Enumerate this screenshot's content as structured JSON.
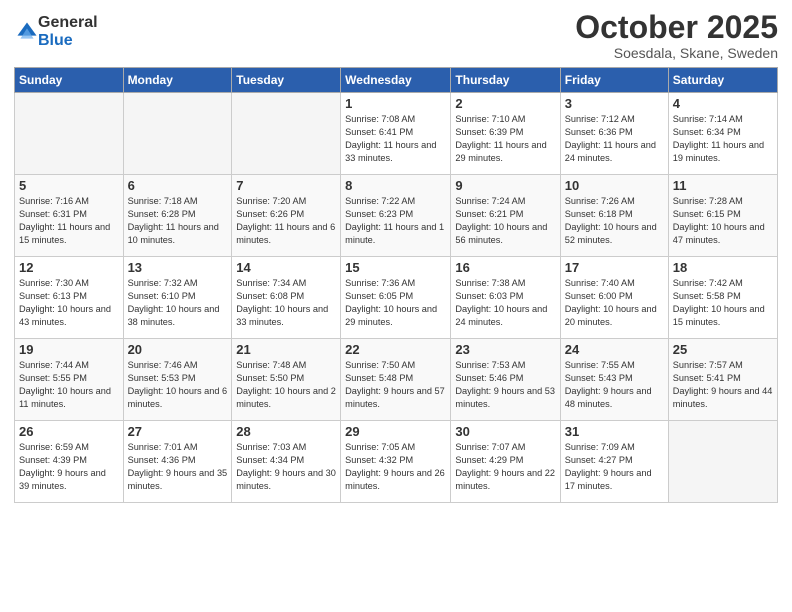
{
  "logo": {
    "general": "General",
    "blue": "Blue"
  },
  "title": "October 2025",
  "subtitle": "Soesdala, Skane, Sweden",
  "days_of_week": [
    "Sunday",
    "Monday",
    "Tuesday",
    "Wednesday",
    "Thursday",
    "Friday",
    "Saturday"
  ],
  "weeks": [
    [
      {
        "day": "",
        "info": ""
      },
      {
        "day": "",
        "info": ""
      },
      {
        "day": "",
        "info": ""
      },
      {
        "day": "1",
        "info": "Sunrise: 7:08 AM\nSunset: 6:41 PM\nDaylight: 11 hours\nand 33 minutes."
      },
      {
        "day": "2",
        "info": "Sunrise: 7:10 AM\nSunset: 6:39 PM\nDaylight: 11 hours\nand 29 minutes."
      },
      {
        "day": "3",
        "info": "Sunrise: 7:12 AM\nSunset: 6:36 PM\nDaylight: 11 hours\nand 24 minutes."
      },
      {
        "day": "4",
        "info": "Sunrise: 7:14 AM\nSunset: 6:34 PM\nDaylight: 11 hours\nand 19 minutes."
      }
    ],
    [
      {
        "day": "5",
        "info": "Sunrise: 7:16 AM\nSunset: 6:31 PM\nDaylight: 11 hours\nand 15 minutes."
      },
      {
        "day": "6",
        "info": "Sunrise: 7:18 AM\nSunset: 6:28 PM\nDaylight: 11 hours\nand 10 minutes."
      },
      {
        "day": "7",
        "info": "Sunrise: 7:20 AM\nSunset: 6:26 PM\nDaylight: 11 hours\nand 6 minutes."
      },
      {
        "day": "8",
        "info": "Sunrise: 7:22 AM\nSunset: 6:23 PM\nDaylight: 11 hours\nand 1 minute."
      },
      {
        "day": "9",
        "info": "Sunrise: 7:24 AM\nSunset: 6:21 PM\nDaylight: 10 hours\nand 56 minutes."
      },
      {
        "day": "10",
        "info": "Sunrise: 7:26 AM\nSunset: 6:18 PM\nDaylight: 10 hours\nand 52 minutes."
      },
      {
        "day": "11",
        "info": "Sunrise: 7:28 AM\nSunset: 6:15 PM\nDaylight: 10 hours\nand 47 minutes."
      }
    ],
    [
      {
        "day": "12",
        "info": "Sunrise: 7:30 AM\nSunset: 6:13 PM\nDaylight: 10 hours\nand 43 minutes."
      },
      {
        "day": "13",
        "info": "Sunrise: 7:32 AM\nSunset: 6:10 PM\nDaylight: 10 hours\nand 38 minutes."
      },
      {
        "day": "14",
        "info": "Sunrise: 7:34 AM\nSunset: 6:08 PM\nDaylight: 10 hours\nand 33 minutes."
      },
      {
        "day": "15",
        "info": "Sunrise: 7:36 AM\nSunset: 6:05 PM\nDaylight: 10 hours\nand 29 minutes."
      },
      {
        "day": "16",
        "info": "Sunrise: 7:38 AM\nSunset: 6:03 PM\nDaylight: 10 hours\nand 24 minutes."
      },
      {
        "day": "17",
        "info": "Sunrise: 7:40 AM\nSunset: 6:00 PM\nDaylight: 10 hours\nand 20 minutes."
      },
      {
        "day": "18",
        "info": "Sunrise: 7:42 AM\nSunset: 5:58 PM\nDaylight: 10 hours\nand 15 minutes."
      }
    ],
    [
      {
        "day": "19",
        "info": "Sunrise: 7:44 AM\nSunset: 5:55 PM\nDaylight: 10 hours\nand 11 minutes."
      },
      {
        "day": "20",
        "info": "Sunrise: 7:46 AM\nSunset: 5:53 PM\nDaylight: 10 hours\nand 6 minutes."
      },
      {
        "day": "21",
        "info": "Sunrise: 7:48 AM\nSunset: 5:50 PM\nDaylight: 10 hours\nand 2 minutes."
      },
      {
        "day": "22",
        "info": "Sunrise: 7:50 AM\nSunset: 5:48 PM\nDaylight: 9 hours\nand 57 minutes."
      },
      {
        "day": "23",
        "info": "Sunrise: 7:53 AM\nSunset: 5:46 PM\nDaylight: 9 hours\nand 53 minutes."
      },
      {
        "day": "24",
        "info": "Sunrise: 7:55 AM\nSunset: 5:43 PM\nDaylight: 9 hours\nand 48 minutes."
      },
      {
        "day": "25",
        "info": "Sunrise: 7:57 AM\nSunset: 5:41 PM\nDaylight: 9 hours\nand 44 minutes."
      }
    ],
    [
      {
        "day": "26",
        "info": "Sunrise: 6:59 AM\nSunset: 4:39 PM\nDaylight: 9 hours\nand 39 minutes."
      },
      {
        "day": "27",
        "info": "Sunrise: 7:01 AM\nSunset: 4:36 PM\nDaylight: 9 hours\nand 35 minutes."
      },
      {
        "day": "28",
        "info": "Sunrise: 7:03 AM\nSunset: 4:34 PM\nDaylight: 9 hours\nand 30 minutes."
      },
      {
        "day": "29",
        "info": "Sunrise: 7:05 AM\nSunset: 4:32 PM\nDaylight: 9 hours\nand 26 minutes."
      },
      {
        "day": "30",
        "info": "Sunrise: 7:07 AM\nSunset: 4:29 PM\nDaylight: 9 hours\nand 22 minutes."
      },
      {
        "day": "31",
        "info": "Sunrise: 7:09 AM\nSunset: 4:27 PM\nDaylight: 9 hours\nand 17 minutes."
      },
      {
        "day": "",
        "info": ""
      }
    ]
  ]
}
